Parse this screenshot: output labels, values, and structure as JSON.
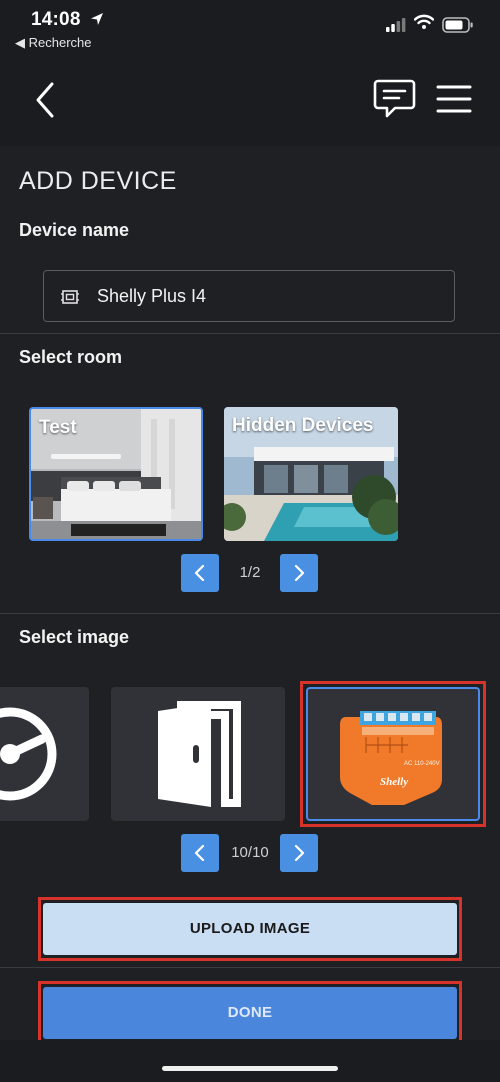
{
  "status": {
    "time": "14:08",
    "back_app": "◀ Recherche"
  },
  "page": {
    "title": "ADD DEVICE",
    "device_name_label": "Device name",
    "device_name_value": "Shelly Plus I4",
    "select_room_label": "Select room",
    "select_image_label": "Select image"
  },
  "rooms": [
    {
      "label": "Test"
    },
    {
      "label": "Hidden Devices"
    }
  ],
  "room_pager": "1/2",
  "image_pager": "10/10",
  "buttons": {
    "upload": "UPLOAD IMAGE",
    "done": "DONE"
  },
  "device_image_text": {
    "label_model": "AC 110-240V",
    "brand": "Shelly"
  },
  "colors": {
    "accent": "#4a90e2",
    "highlight_box": "#d8332a"
  }
}
